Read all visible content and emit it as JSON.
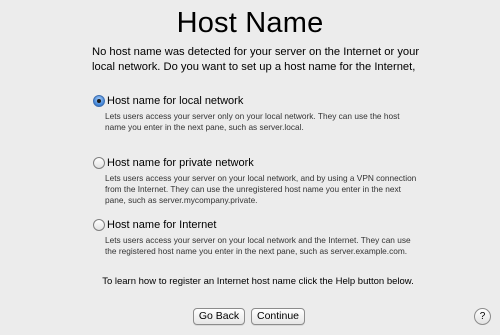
{
  "page": {
    "title": "Host Name",
    "intro": "No host name was detected for your server on the Internet or your local network. Do you want to set up a host name for the Internet,"
  },
  "options": [
    {
      "label": "Host name for local network",
      "description": "Lets users access your server only on your local network. They can use the host name you enter in the next pane, such as server.local.",
      "checked": true
    },
    {
      "label": "Host name for private network",
      "description": "Lets users access your server on your local network, and by using a VPN connection from the Internet. They can use the unregistered host name you enter in the next pane, such as server.mycompany.private.",
      "checked": false
    },
    {
      "label": "Host name for Internet",
      "description": "Lets users access your server on your local network and the Internet. They can use the registered host name you enter in the next pane, such as server.example.com.",
      "checked": false
    }
  ],
  "help_text": "To learn how to register an Internet host name click the Help button below.",
  "buttons": {
    "back": "Go Back",
    "continue": "Continue",
    "help": "?"
  },
  "colors": {
    "background": "#ececec",
    "radio_selected": "#3d82d6"
  }
}
